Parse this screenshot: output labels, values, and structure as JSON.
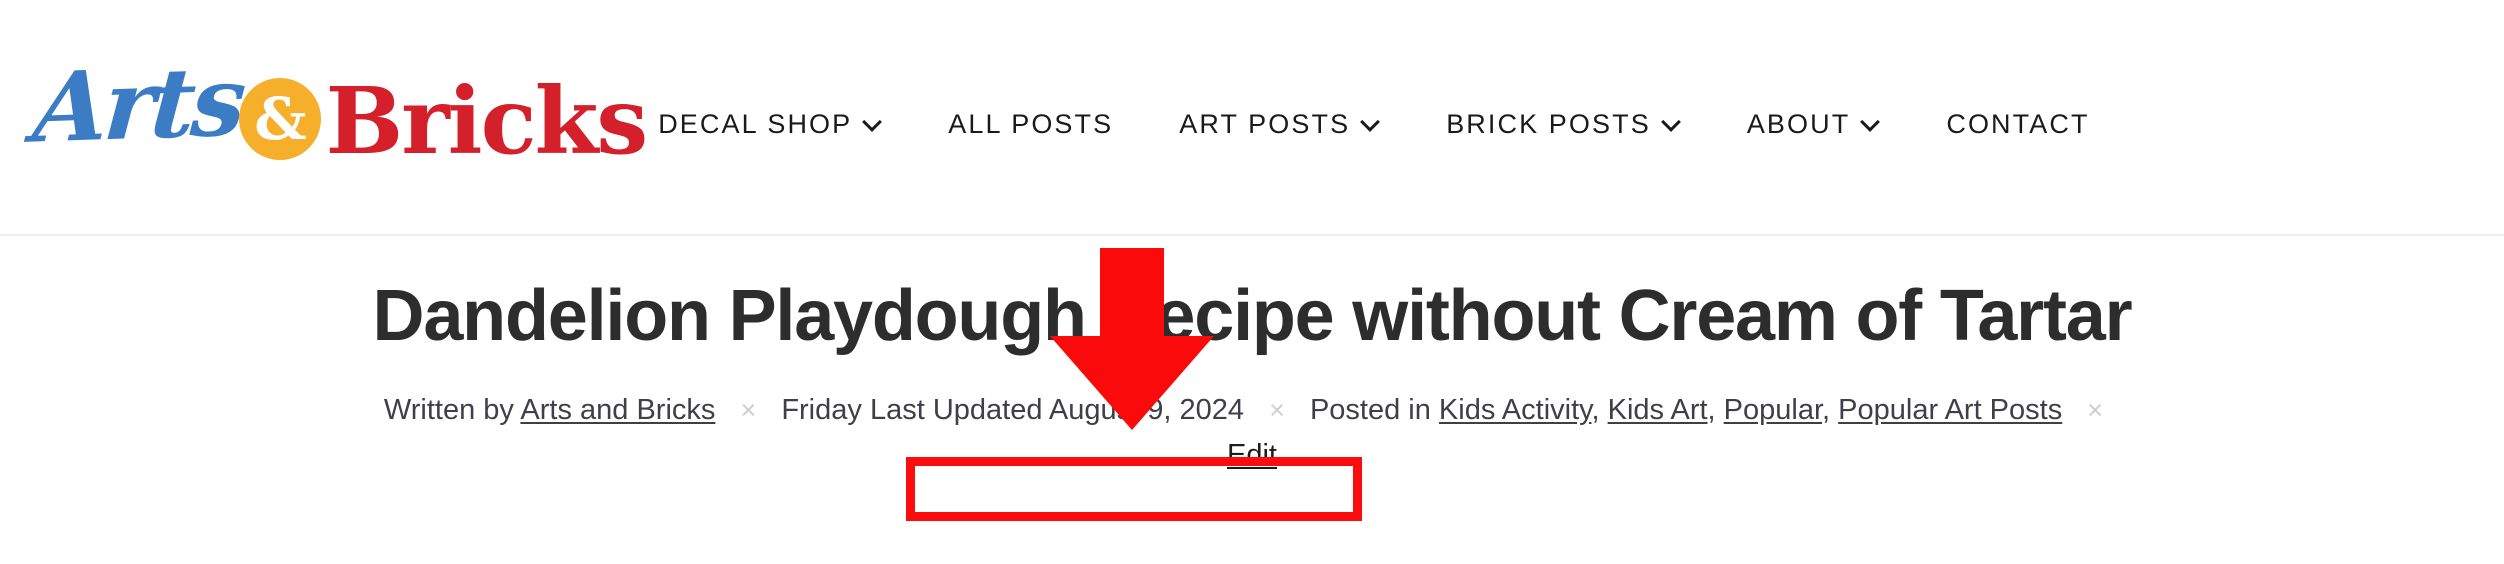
{
  "site": {
    "logo": {
      "word_one": "Arts",
      "ampersand": "&",
      "word_two": "Bricks",
      "color_arts": "#3B7CC4",
      "color_amp_bg": "#F5AF2B",
      "color_bricks": "#D4202A"
    },
    "nav": [
      {
        "label": "DECAL SHOP",
        "has_dropdown": true,
        "icon": "chevron-down-icon",
        "name": "nav-item-decal-shop"
      },
      {
        "label": "ALL POSTS",
        "has_dropdown": false,
        "icon": "",
        "name": "nav-item-all-posts"
      },
      {
        "label": "ART POSTS",
        "has_dropdown": true,
        "icon": "chevron-down-icon",
        "name": "nav-item-art-posts"
      },
      {
        "label": "BRICK POSTS",
        "has_dropdown": true,
        "icon": "chevron-down-icon",
        "name": "nav-item-brick-posts"
      },
      {
        "label": "ABOUT",
        "has_dropdown": true,
        "icon": "chevron-down-icon",
        "name": "nav-item-about"
      },
      {
        "label": "CONTACT",
        "has_dropdown": false,
        "icon": "",
        "name": "nav-item-contact"
      }
    ]
  },
  "article": {
    "title": "Dandelion Playdough Recipe without Cream of Tartar",
    "meta": {
      "written_by_label": "Written by",
      "author": "Arts and Bricks",
      "separator": "×",
      "day_prefix": "Friday",
      "last_updated": "Last Updated August 9, 2024",
      "posted_in_label": "Posted in",
      "categories": [
        {
          "label": "Kids Activity",
          "trailing": ","
        },
        {
          "label": "Kids Art",
          "trailing": ","
        },
        {
          "label": "Popular",
          "trailing": ","
        },
        {
          "label": "Popular Art Posts",
          "trailing": ""
        }
      ]
    },
    "edit_link": "Edit"
  },
  "annotations": {
    "arrow": {
      "name": "red-down-arrow-annotation",
      "color": "#FA0A0A",
      "direction": "down"
    },
    "highlight_box": {
      "name": "red-highlight-box-annotation",
      "color": "#FC0D0D",
      "targets": "Last Updated August 9, 2024"
    }
  }
}
